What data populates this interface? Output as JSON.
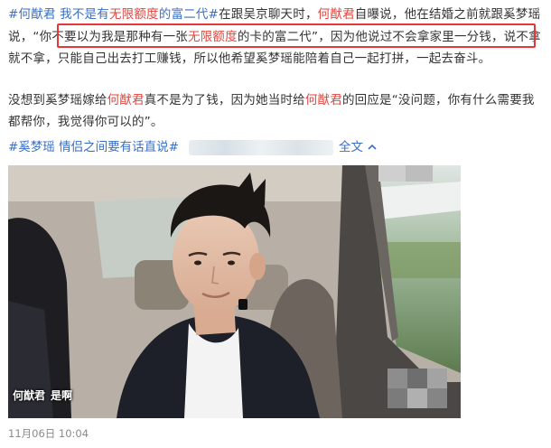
{
  "post": {
    "tag1": "#何猷君",
    "tag2": "我不是有无限额度的富二代#",
    "tag2_pre": "我不是有",
    "tag2_red": "无限额度",
    "tag2_post": "的富二代#",
    "p1_a": "在跟吴京聊天时，",
    "p1_name": "何猷君",
    "p1_b": "自曝说，他在结婚之前就跟奚梦瑶说，",
    "quote_pre": "“你不要以为我是那种有一张",
    "quote_red": "无限额度",
    "quote_post": "的卡的富二代”",
    "p1_c": "，因为他说过不会拿家里一分钱，说不拿就不拿，只能自己出去打工赚钱，所以他希望奚梦瑶能陪着自己一起打拼，一起去奋斗。",
    "p2_a": "没想到奚梦瑶嫁给",
    "p2_name1": "何猷君",
    "p2_b": "真不是为了钱，因为她当时给",
    "p2_name2": "何猷君",
    "p2_c": "的回应是“没问题，你有什么需要我都帮你，我觉得你可以的”。",
    "tag3": "#奚梦瑶 情侣之间要有话直说#",
    "fulltext": "全文",
    "fulltext_icon": "chevron-up-icon",
    "timestamp": "11月06日 10:04"
  },
  "video": {
    "caption_speaker": "何猷君",
    "caption_text": "是啊"
  },
  "colors": {
    "link": "#3a6fc4",
    "highlight": "#e0463f",
    "box": "#e5373a",
    "text": "#333333"
  }
}
